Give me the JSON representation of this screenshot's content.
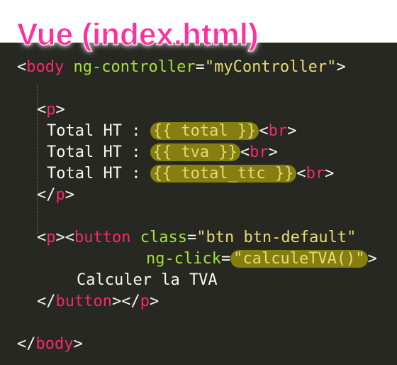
{
  "title": "Vue (index.html)",
  "code": {
    "l1": {
      "lt": "<",
      "tag": "body",
      "attr": "ng-controller",
      "eq": "=",
      "val": "\"myController\"",
      "gt": ">"
    },
    "l3": {
      "lt": "<",
      "tag": "p",
      "gt": ">"
    },
    "l4": {
      "label": "Total HT : ",
      "expr": "{{ total }}",
      "lt": "<",
      "tag": "br",
      "gt": ">"
    },
    "l5": {
      "label": "Total HT : ",
      "expr": "{{ tva }}",
      "lt": "<",
      "tag": "br",
      "gt": ">"
    },
    "l6": {
      "label": "Total HT : ",
      "expr": "{{ total_ttc }}",
      "lt": "<",
      "tag": "br",
      "gt": ">"
    },
    "l7": {
      "lt": "</",
      "tag": "p",
      "gt": ">"
    },
    "l9": {
      "lt1": "<",
      "tag1": "p",
      "gt1": "><",
      "tag2": "button",
      "attr": "class",
      "eq": "=",
      "val": "\"btn btn-default\""
    },
    "l10": {
      "attr": "ng-click",
      "eq": "=",
      "q1": "\"",
      "val": "calculeTVA()",
      "q2": "\"",
      "gt": ">"
    },
    "l11": {
      "text": "Calculer la TVA"
    },
    "l12": {
      "lt1": "</",
      "tag1": "button",
      "mid": "></",
      "tag2": "p",
      "gt": ">"
    },
    "l14": {
      "lt": "</",
      "tag": "body",
      "gt": ">"
    }
  }
}
